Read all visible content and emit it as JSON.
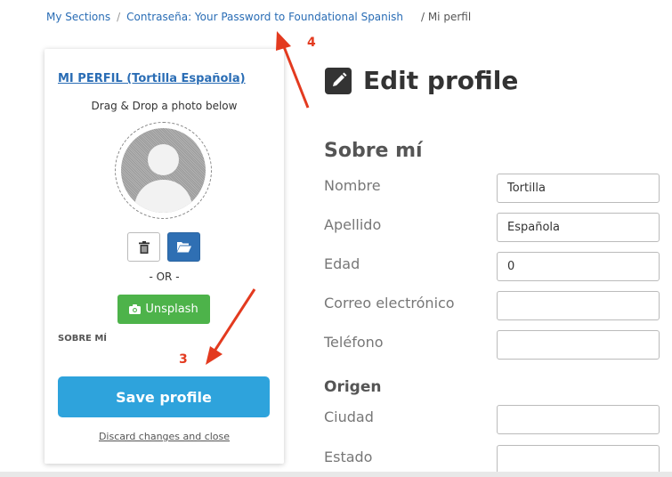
{
  "breadcrumb": {
    "items": [
      "My Sections",
      "Contraseña: Your Password to Foundational Spanish"
    ],
    "current": "/ Mi perfil"
  },
  "card": {
    "title": "MI PERFIL (Tortilla Española)",
    "drag_text": "Drag & Drop a photo below",
    "or_text": "- OR -",
    "unsplash_label": "Unsplash",
    "sobre_label": "SOBRE MÍ",
    "save_label": "Save profile",
    "discard_label": "Discard changes and close"
  },
  "annotations": {
    "step3": "3",
    "step4": "4",
    "color": "#e33a1f"
  },
  "main": {
    "title": "Edit profile",
    "sobre_heading": "Sobre mí",
    "origen_heading": "Origen",
    "fields": [
      {
        "label": "Nombre",
        "value": "Tortilla"
      },
      {
        "label": "Apellido",
        "value": "Española"
      },
      {
        "label": "Edad",
        "value": "0"
      },
      {
        "label": "Correo electrónico",
        "value": ""
      },
      {
        "label": "Teléfono",
        "value": ""
      }
    ],
    "origen_fields": [
      {
        "label": "Ciudad",
        "value": ""
      },
      {
        "label": "Estado",
        "value": ""
      }
    ]
  },
  "colors": {
    "link": "#2a6db5",
    "save": "#2ea3dc",
    "unsplash": "#4db34a",
    "folder": "#2f6fb3"
  }
}
